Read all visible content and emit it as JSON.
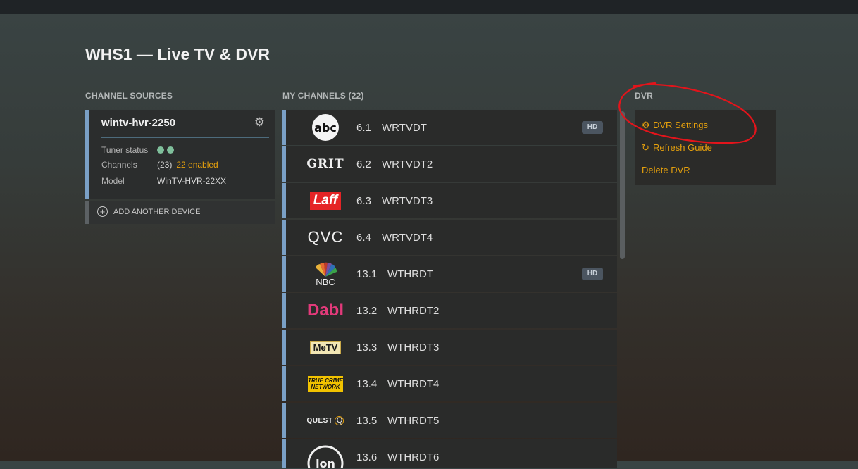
{
  "page_title": "WHS1 — Live TV & DVR",
  "sections": {
    "sources_label": "CHANNEL SOURCES",
    "channels_label": "MY CHANNELS (22)",
    "dvr_label": "DVR"
  },
  "source": {
    "name": "wintv-hvr-2250",
    "tuner_status_label": "Tuner status",
    "channels_label": "Channels",
    "channels_count": "(23)",
    "channels_enabled": "22 enabled",
    "model_label": "Model",
    "model_value": "WinTV-HVR-22XX",
    "status_color": "#7fbf9b",
    "accent": "#7aa0c6"
  },
  "add_device_label": "ADD ANOTHER DEVICE",
  "channels": [
    {
      "number": "6.1",
      "name": "WRTVDT",
      "logo": "abc",
      "hd": "HD"
    },
    {
      "number": "6.2",
      "name": "WRTVDT2",
      "logo": "GRIT",
      "hd": ""
    },
    {
      "number": "6.3",
      "name": "WRTVDT3",
      "logo": "Laff",
      "hd": ""
    },
    {
      "number": "6.4",
      "name": "WRTVDT4",
      "logo": "QVC",
      "hd": ""
    },
    {
      "number": "13.1",
      "name": "WTHRDT",
      "logo": "NBC",
      "hd": "HD"
    },
    {
      "number": "13.2",
      "name": "WTHRDT2",
      "logo": "Dabl",
      "hd": ""
    },
    {
      "number": "13.3",
      "name": "WTHRDT3",
      "logo": "MeTV",
      "hd": ""
    },
    {
      "number": "13.4",
      "name": "WTHRDT4",
      "logo": "TRUE CRIME NETWORK",
      "hd": ""
    },
    {
      "number": "13.5",
      "name": "WTHRDT5",
      "logo": "QUEST",
      "hd": ""
    },
    {
      "number": "13.6",
      "name": "WTHRDT6",
      "logo": "ion",
      "hd": ""
    }
  ],
  "dvr": {
    "settings_label": "DVR Settings",
    "refresh_label": "Refresh Guide",
    "delete_label": "Delete DVR",
    "link_color": "#e5a00d"
  }
}
